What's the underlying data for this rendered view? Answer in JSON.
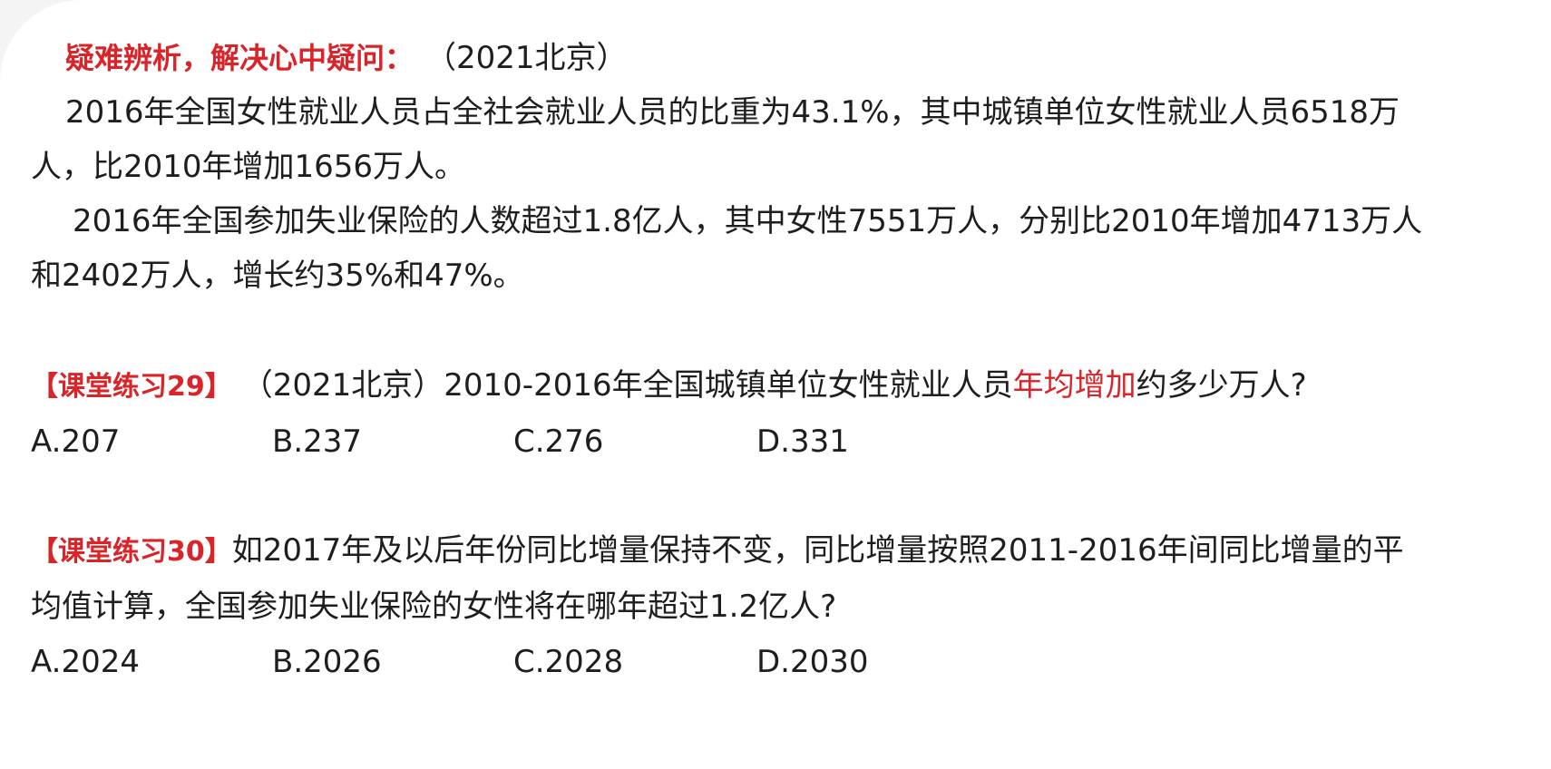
{
  "section": {
    "title": "疑难辨析，解决心中疑问：",
    "source": "（2021北京）"
  },
  "material": {
    "p1_line1": "2016年全国女性就业人员占全社会就业人员的比重为43.1%，其中城镇单位女性就业人员6518万",
    "p1_line2": "人，比2010年增加1656万人。",
    "p2_line1": "2016年全国参加失业保险的人数超过1.8亿人，其中女性7551万人，分别比2010年增加4713万人",
    "p2_line2": "和2402万人，增长约35%和47%。"
  },
  "q29": {
    "tag": "【课堂练习29】",
    "source": "（2021北京）",
    "text_before": "2010-2016年全国城镇单位女性就业人员",
    "highlight": "年均增加",
    "text_after": "约多少万人?",
    "options": [
      "A.207",
      "B.237",
      "C.276",
      "D.331"
    ]
  },
  "q30": {
    "tag": "【课堂练习30】",
    "line1": "如2017年及以后年份同比增量保持不变，同比增量按照2011-2016年间同比增量的平",
    "line2": "均值计算，全国参加失业保险的女性将在哪年超过1.2亿人?",
    "options": [
      "A.2024",
      "B.2026",
      "C.2028",
      "D.2030"
    ]
  }
}
